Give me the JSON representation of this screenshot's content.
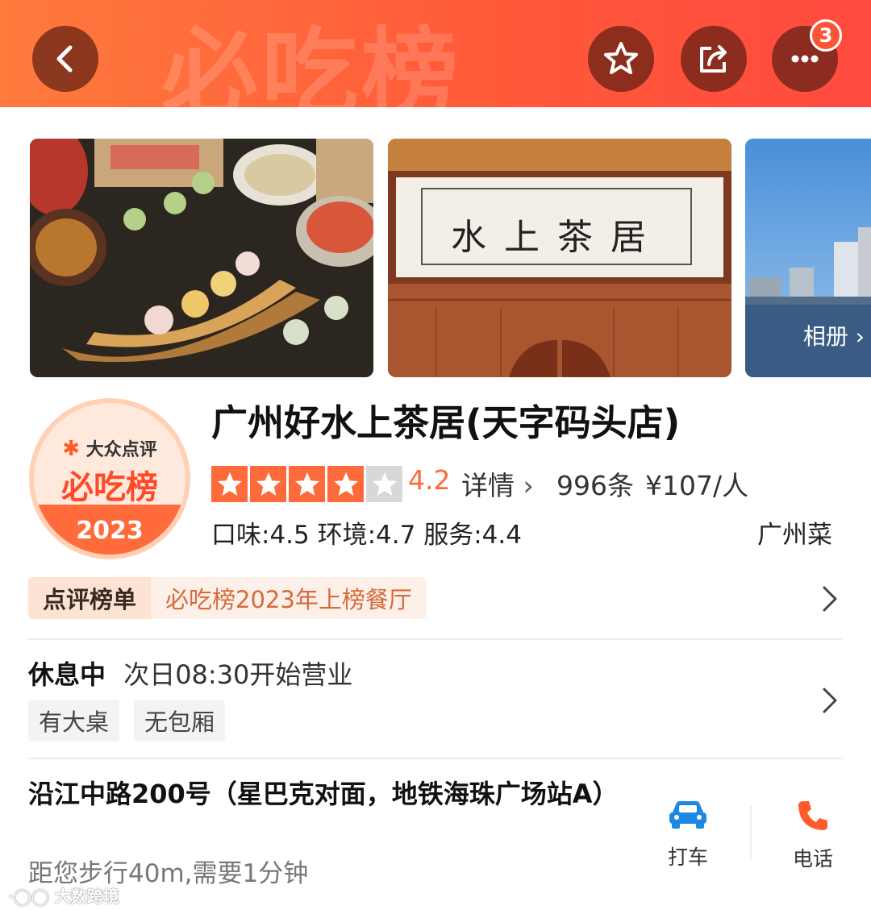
{
  "header": {
    "banner_text": "必吃榜",
    "notification_count": "3",
    "icons": [
      "back-arrow-icon",
      "star-icon",
      "share-icon",
      "more-icon"
    ]
  },
  "gallery": {
    "album_label": "相册 ›",
    "sign_text": "水上茶居"
  },
  "logo": {
    "brand": "大众点评",
    "title": "必吃榜",
    "year": "2023"
  },
  "shop": {
    "name": "广州好水上茶居(天字码头店)",
    "stars": 4,
    "rating": "4.2",
    "detail_link": "详情",
    "review_count": "996条",
    "price": "¥107/人",
    "scores": "口味:4.5  环境:4.7  服务:4.4",
    "cuisine": "广州菜"
  },
  "rank": {
    "label": "点评榜单",
    "text": "必吃榜2023年上榜餐厅"
  },
  "hours": {
    "status": "休息中",
    "next_open": "次日08:30开始营业",
    "tags": [
      "有大桌",
      "无包厢"
    ]
  },
  "address": {
    "text": "沿江中路200号（星巴克对面，地铁海珠广场站A）",
    "distance": "距您步行40m,需要1分钟",
    "taxi_label": "打车",
    "phone_label": "电话"
  },
  "watermark": "大数跨境",
  "colors": {
    "accent": "#ff6a3a",
    "rating_text": "#ff6a3a",
    "header_start": "#ff7a3d",
    "header_end": "#ff4a3f",
    "taxi_icon": "#1e88e5",
    "phone_icon": "#ff5a2a"
  }
}
